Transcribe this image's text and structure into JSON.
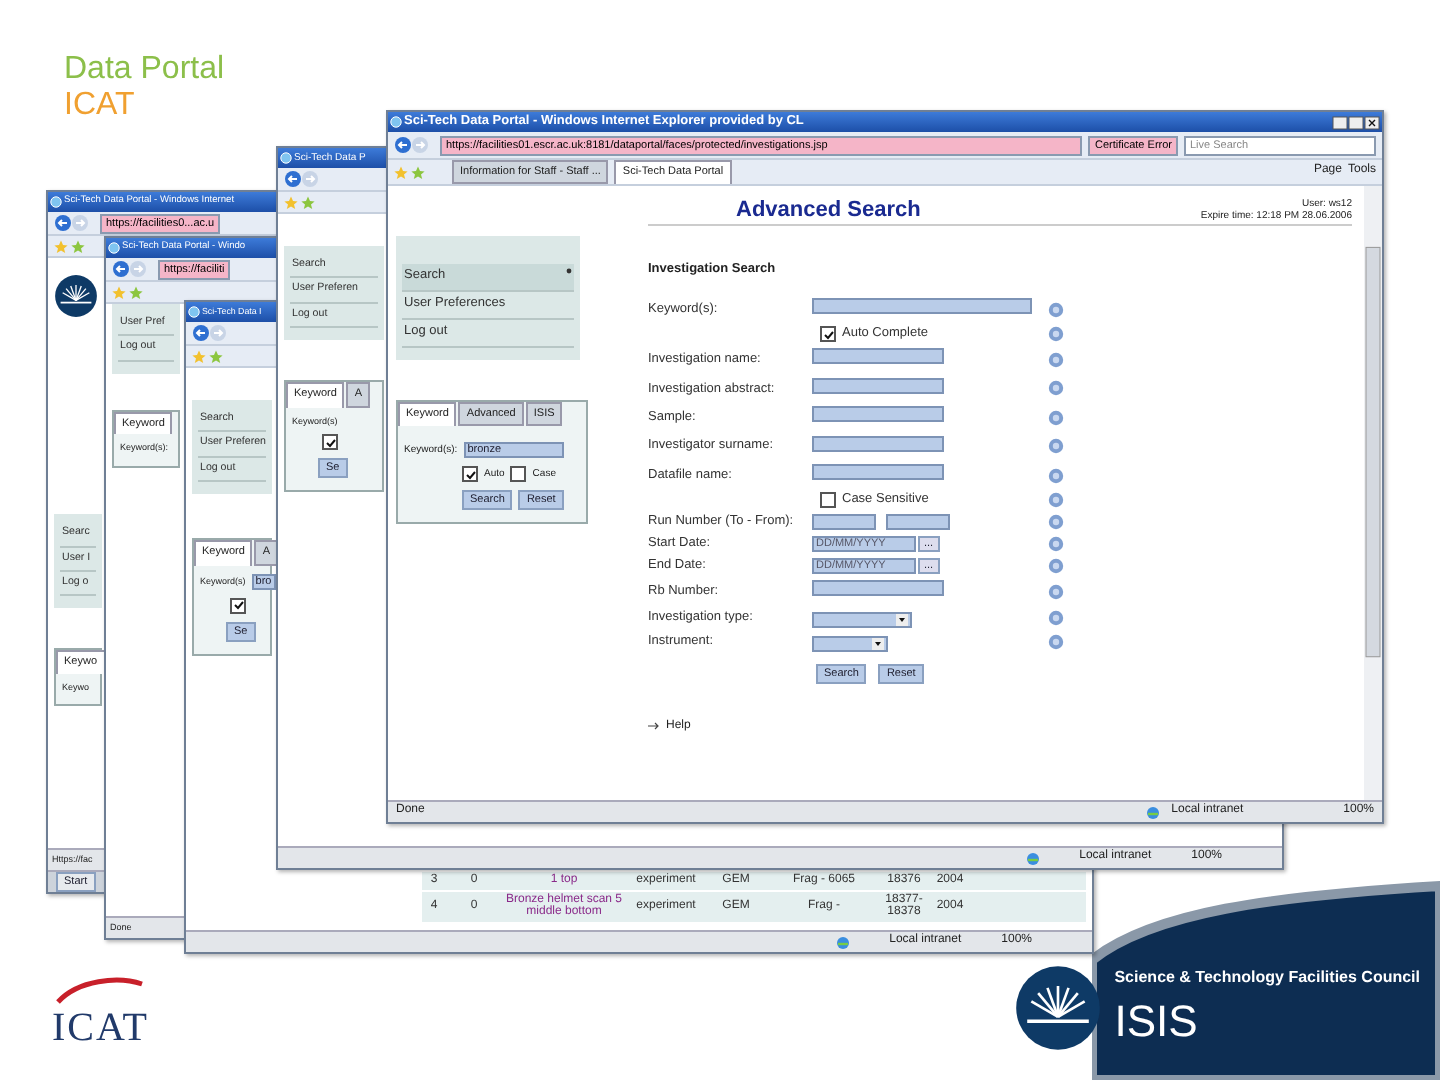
{
  "slide": {
    "title": "Data Portal",
    "subtitle": "ICAT"
  },
  "back_windows": [
    {
      "title": "Sci-Tech Data Portal - Windows Internet",
      "url": "https://facilities0...ac.u",
      "logo": true,
      "menu": [
        "Searc",
        "User I",
        "Log o"
      ],
      "tabs": [
        {
          "label": "Keywo",
          "selected": true
        }
      ],
      "keyword_label": "Keywo",
      "status": "Https://fac",
      "taskbar": "Start"
    },
    {
      "title": "Sci-Tech Data Portal - Windo",
      "url": "https://faciliti",
      "menu": [
        "User Pref",
        "Log out"
      ],
      "tabs": [
        {
          "label": "Keyword",
          "selected": true
        }
      ],
      "keyword_label": "Keyword(s):",
      "status": "Done"
    },
    {
      "title": "Sci-Tech Data I",
      "menu": [
        "Search",
        "User Preferen",
        "Log out"
      ],
      "tabs": [
        {
          "label": "Keyword",
          "selected": true
        },
        {
          "label": "A",
          "selected": false
        }
      ],
      "keyword_label": "Keyword(s)",
      "keyword_value": "bro",
      "auto_checked": true,
      "button": "Se",
      "rows": [
        {
          "cells": [
            "3",
            "0",
            "1 top",
            "experiment",
            "GEM",
            "Frag - 6065",
            "18376",
            "2004"
          ]
        },
        {
          "cells": [
            "4",
            "0",
            "Bronze helmet scan 5 middle bottom",
            "experiment",
            "GEM",
            "Frag -",
            "18377- 18378",
            "2004"
          ]
        }
      ],
      "zone": "Local intranet",
      "zoom": "100%"
    },
    {
      "title": "Sci-Tech Data P",
      "menu": [
        "Search",
        "User Preferen",
        "Log out"
      ],
      "tabs": [
        {
          "label": "Keyword",
          "selected": true
        },
        {
          "label": "A",
          "selected": false
        }
      ],
      "keyword_label": "Keyword(s)",
      "auto_checked": true,
      "button": "Se",
      "zone": "Local intranet",
      "zoom": "100%"
    }
  ],
  "window": {
    "title": "Sci-Tech Data Portal - Windows Internet Explorer provided by CL",
    "url": "https://facilities01.escr.ac.uk:8181/dataportal/faces/protected/investigations.jsp",
    "certificate": "Certificate Error",
    "search_placeholder": "Live Search",
    "tabs": [
      {
        "label": "Information for Staff - Staff ...",
        "selected": false
      },
      {
        "label": "Sci-Tech Data Portal",
        "selected": true
      }
    ],
    "toolbar": [
      "Page",
      "Tools"
    ],
    "status": "Done",
    "zone": "Local intranet",
    "zoom": "100%"
  },
  "page": {
    "heading": "Advanced Search",
    "user": "User: ws12",
    "expire": "Expire time: 12:18 PM 28.06.2006",
    "menu": [
      {
        "label": "Search",
        "selected": true
      },
      {
        "label": "User Preferences",
        "selected": false
      },
      {
        "label": "Log out",
        "selected": false
      }
    ],
    "keyword_panel": {
      "tabs": [
        {
          "label": "Keyword",
          "selected": true
        },
        {
          "label": "Advanced",
          "selected": false
        },
        {
          "label": "ISIS",
          "selected": false
        }
      ],
      "label": "Keyword(s):",
      "value": "bronze",
      "options": [
        {
          "label": "Auto",
          "checked": true
        },
        {
          "label": "Case",
          "checked": false
        }
      ],
      "buttons": [
        "Search",
        "Reset"
      ]
    },
    "form": {
      "title": "Investigation Search",
      "rows": [
        {
          "kind": "text",
          "label": "Keyword(s):",
          "wide": true
        },
        {
          "kind": "check",
          "label": "Auto Complete",
          "checked": true
        },
        {
          "kind": "text",
          "label": "Investigation name:",
          "wide": false
        },
        {
          "kind": "text",
          "label": "Investigation abstract:",
          "wide": false
        },
        {
          "kind": "text",
          "label": "Sample:",
          "wide": false
        },
        {
          "kind": "text",
          "label": "Investigator surname:",
          "wide": false
        },
        {
          "kind": "text",
          "label": "Datafile name:",
          "wide": false
        },
        {
          "kind": "check",
          "label": "Case Sensitive",
          "checked": false
        },
        {
          "kind": "range",
          "label": "Run Number (To - From):"
        },
        {
          "kind": "date",
          "label": "Start Date:",
          "placeholder": "DD/MM/YYYY",
          "button": "..."
        },
        {
          "kind": "date",
          "label": "End Date:",
          "placeholder": "DD/MM/YYYY",
          "button": "..."
        },
        {
          "kind": "text",
          "label": "Rb Number:",
          "wide": false
        },
        {
          "kind": "select",
          "label": "Investigation type:",
          "wide": true
        },
        {
          "kind": "select",
          "label": "Instrument:",
          "wide": false
        }
      ],
      "buttons": [
        "Search",
        "Reset"
      ],
      "help_link": "Help"
    }
  },
  "footer": {
    "council": "Science & Technology Facilities Council",
    "facility": "ISIS",
    "logo_text": "ICAT"
  }
}
